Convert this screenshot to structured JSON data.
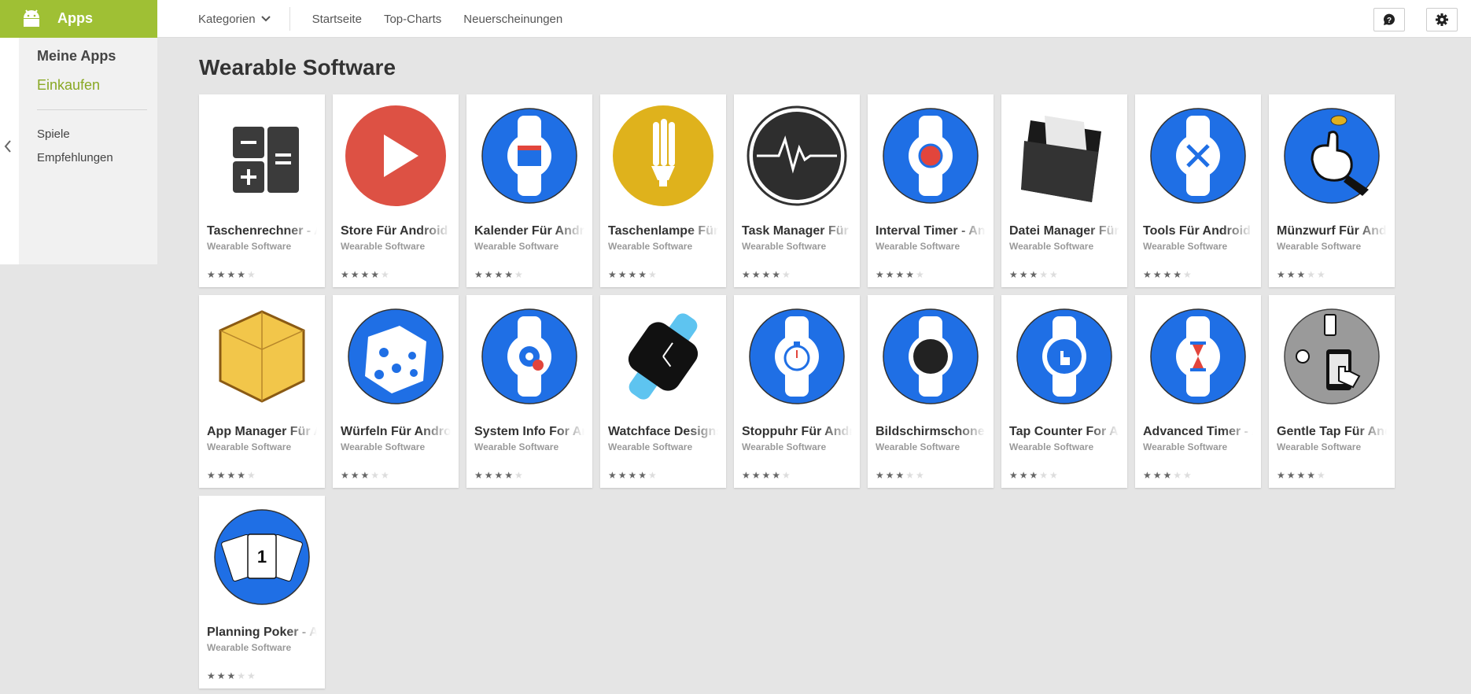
{
  "topbar": {
    "apps_label": "Apps",
    "nav": {
      "kategorien": "Kategorien",
      "startseite": "Startseite",
      "top_charts": "Top-Charts",
      "neuerscheinungen": "Neuerscheinungen"
    }
  },
  "sidebar": {
    "meine_apps": "Meine Apps",
    "einkaufen": "Einkaufen",
    "spiele": "Spiele",
    "empfehlungen": "Empfehlungen"
  },
  "page": {
    "title": "Wearable Software"
  },
  "colors": {
    "brand": "#9fc034",
    "accent_text": "#89a824",
    "icon_blue": "#1f6fe5"
  },
  "apps": [
    {
      "title": "Taschenrechner - A",
      "developer": "Wearable Software",
      "rating": 4,
      "icon": "calculator-icon"
    },
    {
      "title": "Store Für Android W",
      "developer": "Wearable Software",
      "rating": 4,
      "icon": "play-store-icon"
    },
    {
      "title": "Kalender Für Andro",
      "developer": "Wearable Software",
      "rating": 4,
      "icon": "calendar-watch-icon"
    },
    {
      "title": "Taschenlampe Für A",
      "developer": "Wearable Software",
      "rating": 4,
      "icon": "flashlight-icon"
    },
    {
      "title": "Task Manager Für A",
      "developer": "Wearable Software",
      "rating": 4,
      "icon": "task-manager-icon"
    },
    {
      "title": "Interval Timer - An",
      "developer": "Wearable Software",
      "rating": 4,
      "icon": "interval-timer-watch-icon"
    },
    {
      "title": "Datei Manager Für",
      "developer": "Wearable Software",
      "rating": 3.5,
      "icon": "file-manager-icon"
    },
    {
      "title": "Tools Für Android W",
      "developer": "Wearable Software",
      "rating": 4,
      "icon": "tools-watch-icon"
    },
    {
      "title": "Münzwurf Für Andr",
      "developer": "Wearable Software",
      "rating": 3,
      "icon": "coin-flip-icon"
    },
    {
      "title": "App Manager Für A",
      "developer": "Wearable Software",
      "rating": 4.5,
      "icon": "app-box-icon"
    },
    {
      "title": "Würfeln Für Android",
      "developer": "Wearable Software",
      "rating": 3.5,
      "icon": "dice-icon"
    },
    {
      "title": "System Info For An",
      "developer": "Wearable Software",
      "rating": 4.5,
      "icon": "system-info-watch-icon"
    },
    {
      "title": "Watchface Designs",
      "developer": "Wearable Software",
      "rating": 4,
      "icon": "watchface-icon"
    },
    {
      "title": "Stoppuhr Für Andro",
      "developer": "Wearable Software",
      "rating": 4,
      "icon": "stopwatch-watch-icon"
    },
    {
      "title": "Bildschirmschoner",
      "developer": "Wearable Software",
      "rating": 3,
      "icon": "screensaver-watch-icon"
    },
    {
      "title": "Tap Counter For An",
      "developer": "Wearable Software",
      "rating": 3.5,
      "icon": "tap-counter-watch-icon"
    },
    {
      "title": "Advanced Timer - A",
      "developer": "Wearable Software",
      "rating": 3.5,
      "icon": "hourglass-watch-icon"
    },
    {
      "title": "Gentle Tap Für And",
      "developer": "Wearable Software",
      "rating": 4,
      "icon": "gentle-tap-icon"
    },
    {
      "title": "Planning Poker - Ar",
      "developer": "Wearable Software",
      "rating": 3,
      "icon": "planning-poker-icon"
    }
  ]
}
